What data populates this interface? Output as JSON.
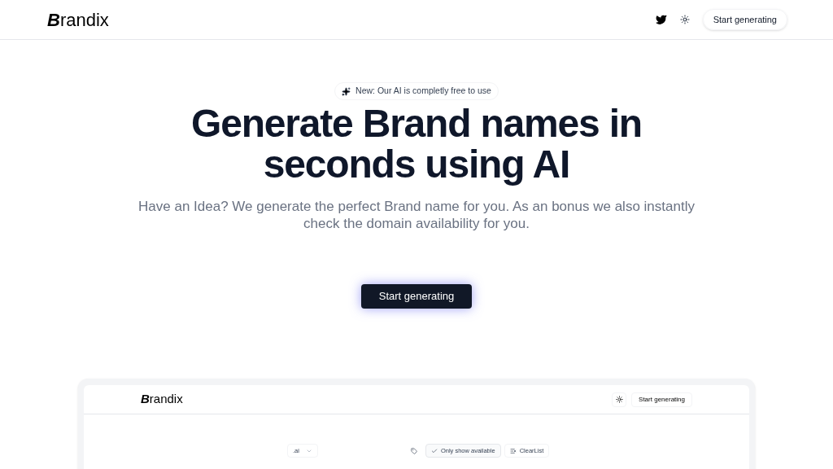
{
  "header": {
    "logo": {
      "initial": "B",
      "rest": "randix"
    },
    "cta": "Start generating"
  },
  "hero": {
    "badge": "New: Our AI is completly free to use",
    "title_lines": [
      "Generate Brand names in",
      "seconds using AI"
    ],
    "subtitle": "Have an Idea? We generate the perfect Brand name for you. As an bonus we also instantly check the domain availability for you.",
    "cta": "Start generating"
  },
  "preview": {
    "logo": {
      "initial": "B",
      "rest": "randix"
    },
    "cta": "Start generating",
    "tld_select": ".ai",
    "only_available": {
      "label": "Only show available",
      "checked": true
    },
    "clear": "ClearList"
  }
}
